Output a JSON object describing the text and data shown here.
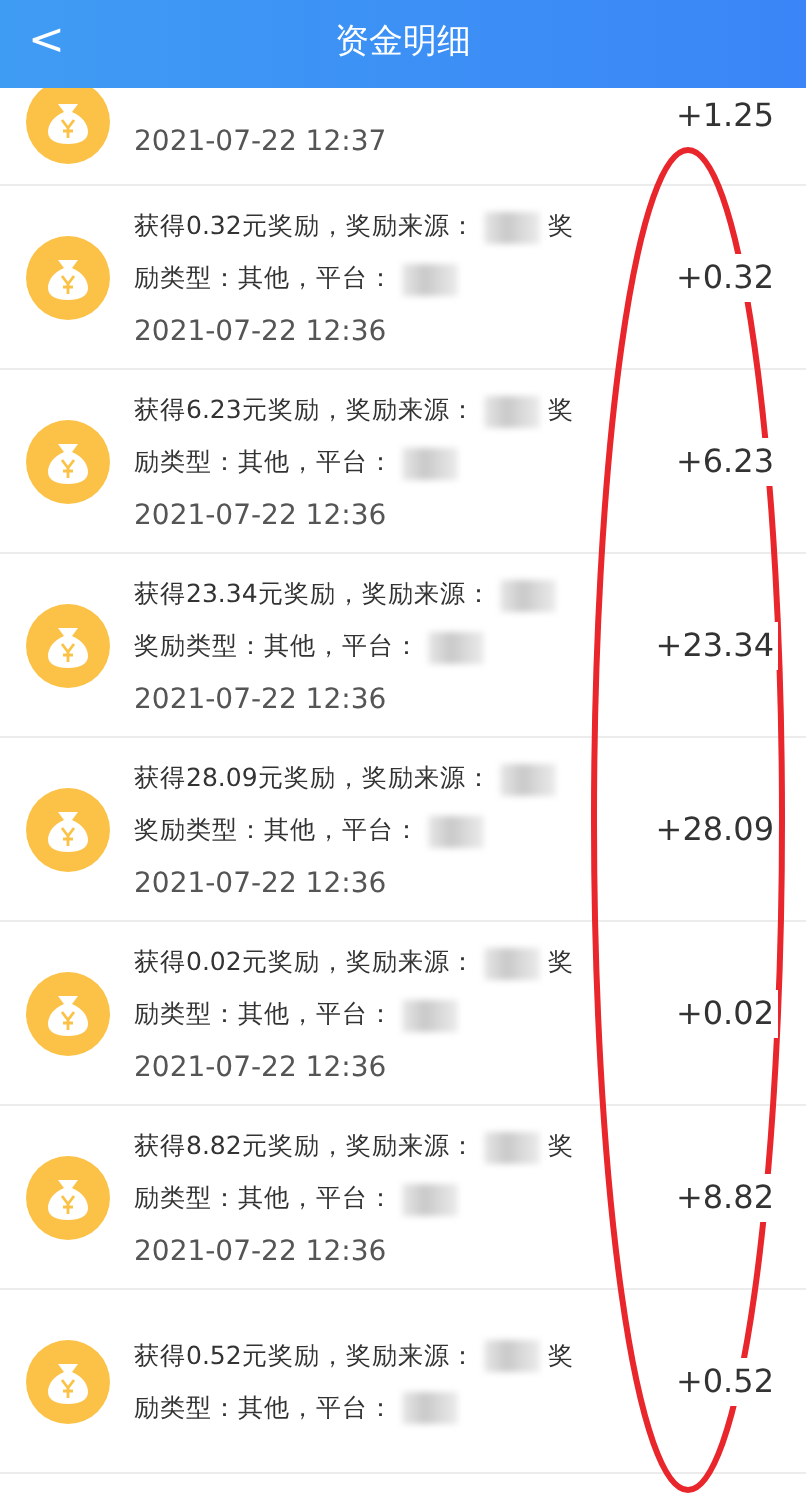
{
  "header": {
    "back": "<",
    "title": "资金明细"
  },
  "records": [
    {
      "kind": "partial",
      "date": "2021-07-22 12:37",
      "amount": "+1.25"
    },
    {
      "kind": "full",
      "parts": [
        "获得0.32元奖励，奖励来源：",
        "奖励类型：其他，平台："
      ],
      "date": "2021-07-22 12:36",
      "amount": "+0.32"
    },
    {
      "kind": "full",
      "parts": [
        "获得6.23元奖励，奖励来源：",
        "奖励类型：其他，平台："
      ],
      "date": "2021-07-22 12:36",
      "amount": "+6.23"
    },
    {
      "kind": "full",
      "parts": [
        "获得23.34元奖励，奖励来源：",
        "奖励类型：其他，平台："
      ],
      "date": "2021-07-22 12:36",
      "amount": "+23.34"
    },
    {
      "kind": "full",
      "parts": [
        "获得28.09元奖励，奖励来源：",
        "奖励类型：其他，平台："
      ],
      "date": "2021-07-22 12:36",
      "amount": "+28.09"
    },
    {
      "kind": "full",
      "parts": [
        "获得0.02元奖励，奖励来源：",
        "奖励类型：其他，平台："
      ],
      "date": "2021-07-22 12:36",
      "amount": "+0.02"
    },
    {
      "kind": "full",
      "parts": [
        "获得8.82元奖励，奖励来源：",
        "奖励类型：其他，平台："
      ],
      "date": "2021-07-22 12:36",
      "amount": "+8.82"
    },
    {
      "kind": "full",
      "parts": [
        "获得0.52元奖励，奖励来源：",
        "奖励类型：其他，平台："
      ],
      "amount": "+0.52"
    }
  ]
}
